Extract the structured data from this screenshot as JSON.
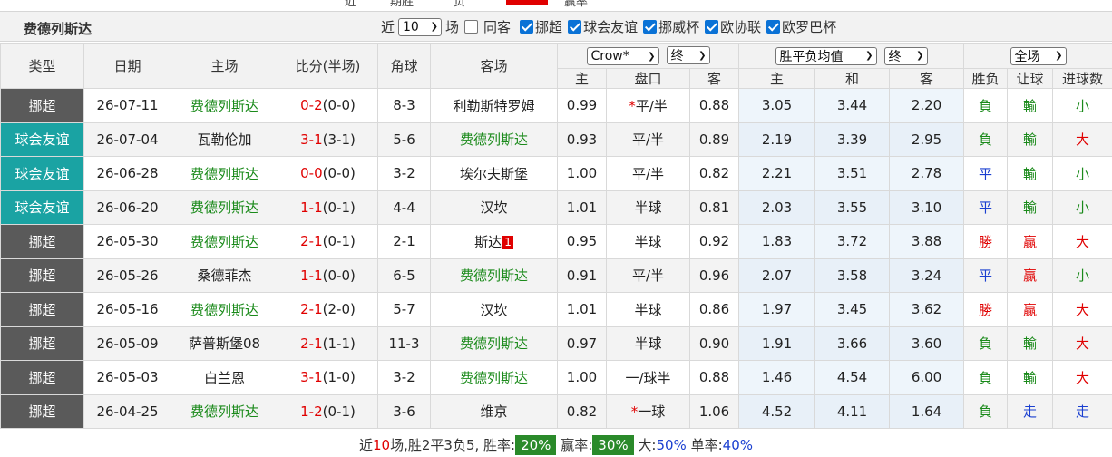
{
  "top": {
    "fragments": [
      "近",
      "期胜",
      "负",
      "胜",
      "赢率"
    ]
  },
  "header": {
    "team_name": "费德列斯达",
    "near_label": "近",
    "near_count": "10",
    "games_label": "场",
    "same_home_label": "同客",
    "filters": [
      {
        "label": "挪超",
        "checked": true
      },
      {
        "label": "球会友谊",
        "checked": true
      },
      {
        "label": "挪威杯",
        "checked": true
      },
      {
        "label": "欧协联",
        "checked": true
      },
      {
        "label": "欧罗巴杯",
        "checked": true
      }
    ]
  },
  "columns": {
    "type": "类型",
    "date": "日期",
    "home": "主场",
    "score": "比分(半场)",
    "corner": "角球",
    "away": "客场",
    "company": "Crow*",
    "stage1": "终",
    "odds_type": "胜平负均值",
    "stage2": "终",
    "scope": "全场",
    "ah_home": "主",
    "ah_line": "盘口",
    "ah_away": "客",
    "eu_home": "主",
    "eu_draw": "和",
    "eu_away": "客",
    "res": "胜负",
    "hcp": "让球",
    "ou": "进球数"
  },
  "colors": {
    "league_norway": "#5a5a5a",
    "league_friendly": "#1aa3a3",
    "home_team_green": "#1a8a1a",
    "score_red": "#e00000",
    "result_blue": "#1a3fd0"
  },
  "matches": [
    {
      "league": "挪超",
      "league_kind": "norway",
      "date": "26-07-11",
      "home": "费德列斯达",
      "home_is_team": true,
      "score_h": "0",
      "score_a": "2",
      "half": "(0-0)",
      "score_color_side": "home",
      "corner": "8-3",
      "away": "利勒斯特罗姆",
      "away_is_team": false,
      "away_mark": "",
      "ah_h": "0.99",
      "ah_line_star": "*",
      "ah_line": "平/半",
      "ah_a": "0.88",
      "eu_h": "3.05",
      "eu_d": "3.44",
      "eu_a": "2.20",
      "res": "負",
      "res_color": "green",
      "hcp": "輸",
      "hcp_color": "green",
      "ou": "小",
      "ou_color": "green"
    },
    {
      "league": "球会友谊",
      "league_kind": "friendly",
      "date": "26-07-04",
      "home": "瓦勒伦加",
      "home_is_team": false,
      "score_h": "3",
      "score_a": "1",
      "half": "(3-1)",
      "score_color_side": "home",
      "corner": "5-6",
      "away": "费德列斯达",
      "away_is_team": true,
      "away_mark": "",
      "ah_h": "0.93",
      "ah_line_star": "",
      "ah_line": "平/半",
      "ah_a": "0.89",
      "eu_h": "2.19",
      "eu_d": "3.39",
      "eu_a": "2.95",
      "res": "負",
      "res_color": "green",
      "hcp": "輸",
      "hcp_color": "green",
      "ou": "大",
      "ou_color": "red"
    },
    {
      "league": "球会友谊",
      "league_kind": "friendly",
      "date": "26-06-28",
      "home": "费德列斯达",
      "home_is_team": true,
      "score_h": "0",
      "score_a": "0",
      "half": "(0-0)",
      "score_color_side": "home",
      "corner": "3-2",
      "away": "埃尔夫斯堡",
      "away_is_team": false,
      "away_mark": "",
      "ah_h": "1.00",
      "ah_line_star": "",
      "ah_line": "平/半",
      "ah_a": "0.82",
      "eu_h": "2.21",
      "eu_d": "3.51",
      "eu_a": "2.78",
      "res": "平",
      "res_color": "blue",
      "hcp": "輸",
      "hcp_color": "green",
      "ou": "小",
      "ou_color": "green"
    },
    {
      "league": "球会友谊",
      "league_kind": "friendly",
      "date": "26-06-20",
      "home": "费德列斯达",
      "home_is_team": true,
      "score_h": "1",
      "score_a": "1",
      "half": "(0-1)",
      "score_color_side": "home",
      "corner": "4-4",
      "away": "汉坎",
      "away_is_team": false,
      "away_mark": "",
      "ah_h": "1.01",
      "ah_line_star": "",
      "ah_line": "半球",
      "ah_a": "0.81",
      "eu_h": "2.03",
      "eu_d": "3.55",
      "eu_a": "3.10",
      "res": "平",
      "res_color": "blue",
      "hcp": "輸",
      "hcp_color": "green",
      "ou": "小",
      "ou_color": "green"
    },
    {
      "league": "挪超",
      "league_kind": "norway",
      "date": "26-05-30",
      "home": "费德列斯达",
      "home_is_team": true,
      "score_h": "2",
      "score_a": "1",
      "half": "(0-1)",
      "score_color_side": "home",
      "corner": "2-1",
      "away": "斯达",
      "away_is_team": false,
      "away_mark": "1",
      "ah_h": "0.95",
      "ah_line_star": "",
      "ah_line": "半球",
      "ah_a": "0.92",
      "eu_h": "1.83",
      "eu_d": "3.72",
      "eu_a": "3.88",
      "res": "勝",
      "res_color": "red",
      "hcp": "贏",
      "hcp_color": "red",
      "ou": "大",
      "ou_color": "red"
    },
    {
      "league": "挪超",
      "league_kind": "norway",
      "date": "26-05-26",
      "home": "桑德菲杰",
      "home_is_team": false,
      "score_h": "1",
      "score_a": "1",
      "half": "(0-0)",
      "score_color_side": "home",
      "corner": "6-5",
      "away": "费德列斯达",
      "away_is_team": true,
      "away_mark": "",
      "ah_h": "0.91",
      "ah_line_star": "",
      "ah_line": "平/半",
      "ah_a": "0.96",
      "eu_h": "2.07",
      "eu_d": "3.58",
      "eu_a": "3.24",
      "res": "平",
      "res_color": "blue",
      "hcp": "贏",
      "hcp_color": "red",
      "ou": "小",
      "ou_color": "green"
    },
    {
      "league": "挪超",
      "league_kind": "norway",
      "date": "26-05-16",
      "home": "费德列斯达",
      "home_is_team": true,
      "score_h": "2",
      "score_a": "1",
      "half": "(2-0)",
      "score_color_side": "home",
      "corner": "5-7",
      "away": "汉坎",
      "away_is_team": false,
      "away_mark": "",
      "ah_h": "1.01",
      "ah_line_star": "",
      "ah_line": "半球",
      "ah_a": "0.86",
      "eu_h": "1.97",
      "eu_d": "3.45",
      "eu_a": "3.62",
      "res": "勝",
      "res_color": "red",
      "hcp": "贏",
      "hcp_color": "red",
      "ou": "大",
      "ou_color": "red"
    },
    {
      "league": "挪超",
      "league_kind": "norway",
      "date": "26-05-09",
      "home": "萨普斯堡08",
      "home_is_team": false,
      "score_h": "2",
      "score_a": "1",
      "half": "(1-1)",
      "score_color_side": "home",
      "corner": "11-3",
      "away": "费德列斯达",
      "away_is_team": true,
      "away_mark": "",
      "ah_h": "0.97",
      "ah_line_star": "",
      "ah_line": "半球",
      "ah_a": "0.90",
      "eu_h": "1.91",
      "eu_d": "3.66",
      "eu_a": "3.60",
      "res": "負",
      "res_color": "green",
      "hcp": "輸",
      "hcp_color": "green",
      "ou": "大",
      "ou_color": "red"
    },
    {
      "league": "挪超",
      "league_kind": "norway",
      "date": "26-05-03",
      "home": "白兰恩",
      "home_is_team": false,
      "score_h": "3",
      "score_a": "1",
      "half": "(1-0)",
      "score_color_side": "home",
      "corner": "3-2",
      "away": "费德列斯达",
      "away_is_team": true,
      "away_mark": "",
      "ah_h": "1.00",
      "ah_line_star": "",
      "ah_line": "一/球半",
      "ah_a": "0.88",
      "eu_h": "1.46",
      "eu_d": "4.54",
      "eu_a": "6.00",
      "res": "負",
      "res_color": "green",
      "hcp": "輸",
      "hcp_color": "green",
      "ou": "大",
      "ou_color": "red"
    },
    {
      "league": "挪超",
      "league_kind": "norway",
      "date": "26-04-25",
      "home": "费德列斯达",
      "home_is_team": true,
      "score_h": "1",
      "score_a": "2",
      "half": "(0-1)",
      "score_color_side": "home",
      "corner": "3-6",
      "away": "维京",
      "away_is_team": false,
      "away_mark": "",
      "ah_h": "0.82",
      "ah_line_star": "*",
      "ah_line": "一球",
      "ah_a": "1.06",
      "eu_h": "4.52",
      "eu_d": "4.11",
      "eu_a": "1.64",
      "res": "負",
      "res_color": "green",
      "hcp": "走",
      "hcp_color": "blue",
      "ou": "走",
      "ou_color": "blue"
    }
  ],
  "footer": {
    "prefix": "近",
    "count": "10",
    "summary": "场,胜2平3负5, 胜率:",
    "win_rate": "20%",
    "ying_label": "赢率:",
    "ying_rate": "30%",
    "big_label": "大:",
    "big_rate": "50%",
    "odd_label": "单率:",
    "odd_rate": "40%"
  }
}
